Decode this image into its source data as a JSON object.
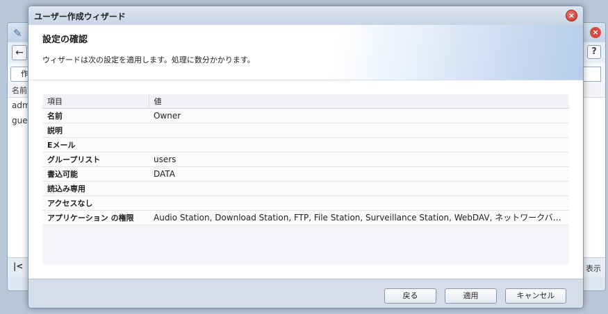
{
  "background_window": {
    "create_label": "作",
    "list_header": "名前",
    "rows": [
      "adm",
      "gue"
    ],
    "display_label": "表示"
  },
  "dialog": {
    "title": "ユーザー作成ウィザード",
    "header_title": "設定の確認",
    "header_desc": "ウィザードは次の設定を適用します。処理に数分かかります。",
    "table": {
      "col_item": "項目",
      "col_value": "値",
      "rows": [
        {
          "item": "名前",
          "value": "Owner"
        },
        {
          "item": "説明",
          "value": ""
        },
        {
          "item": "Eメール",
          "value": ""
        },
        {
          "item": "グループリスト",
          "value": "users"
        },
        {
          "item": "書込可能",
          "value": "DATA"
        },
        {
          "item": "読込み専用",
          "value": ""
        },
        {
          "item": "アクセスなし",
          "value": ""
        },
        {
          "item": "アプリケーション の権限",
          "value": "Audio Station, Download Station, FTP, File Station, Surveillance Station, WebDAV, ネットワークバックアップ..."
        }
      ]
    },
    "buttons": {
      "back": "戻る",
      "apply": "適用",
      "cancel": "キャンセル"
    }
  },
  "colors": {
    "close_red": "#d6493e",
    "footer_bg": "#d4dde8",
    "header_gradient_blue": "#b7cdea"
  }
}
